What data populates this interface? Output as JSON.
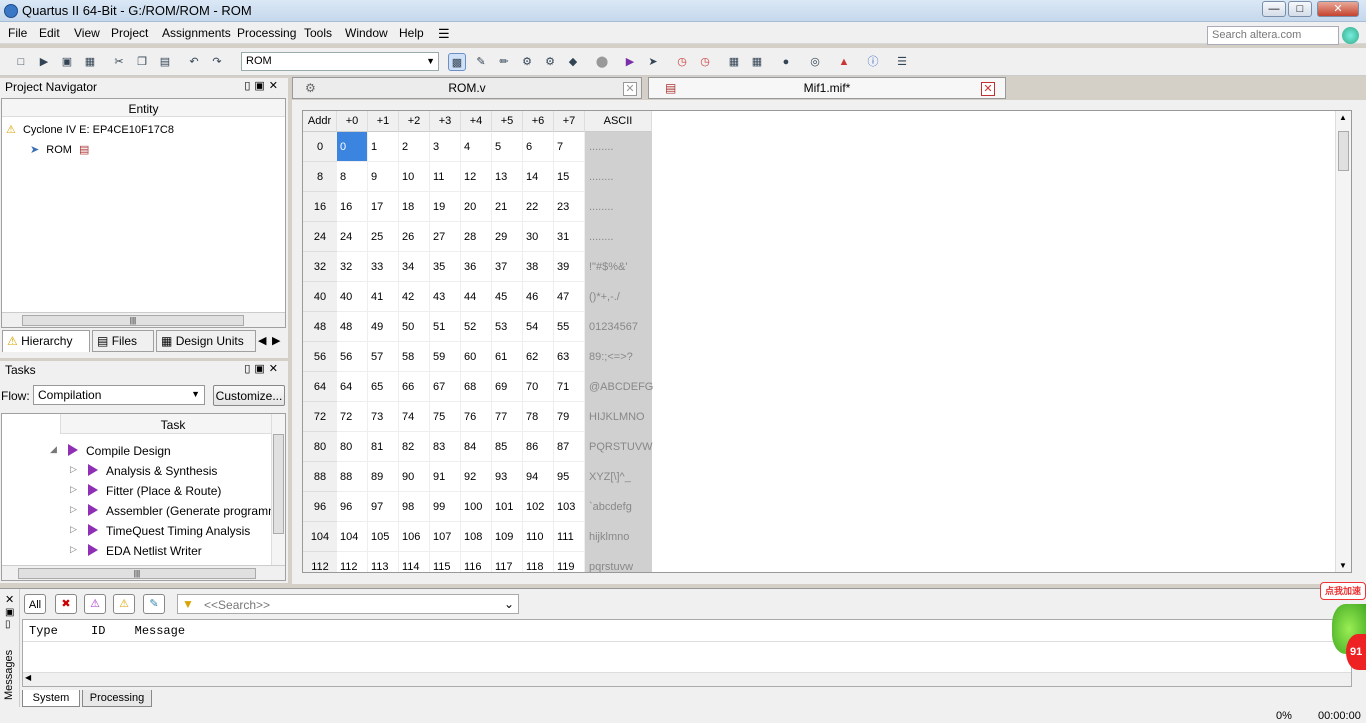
{
  "titlebar": {
    "title": "Quartus II 64-Bit - G:/ROM/ROM - ROM"
  },
  "menu": [
    "File",
    "Edit",
    "View",
    "Project",
    "Assignments",
    "Processing",
    "Tools",
    "Window",
    "Help"
  ],
  "search": {
    "placeholder": "Search altera.com"
  },
  "toolbar": {
    "entity_value": "ROM"
  },
  "project_navigator": {
    "title": "Project Navigator",
    "column": "Entity",
    "device": "Cyclone IV E: EP4CE10F17C8",
    "top_entity": "ROM",
    "tabs": [
      "Hierarchy",
      "Files",
      "Design Units"
    ]
  },
  "tasks": {
    "title": "Tasks",
    "flow_label": "Flow:",
    "flow_value": "Compilation",
    "customize_label": "Customize...",
    "column": "Task",
    "items": [
      {
        "label": "Compile Design"
      },
      {
        "label": "Analysis & Synthesis"
      },
      {
        "label": "Fitter (Place & Route)"
      },
      {
        "label": "Assembler (Generate programming"
      },
      {
        "label": "TimeQuest Timing Analysis"
      },
      {
        "label": "EDA Netlist Writer"
      }
    ]
  },
  "editor_tabs": [
    {
      "label": "ROM.v"
    },
    {
      "label": "Mif1.mif*"
    }
  ],
  "mif": {
    "headers": [
      "Addr",
      "+0",
      "+1",
      "+2",
      "+3",
      "+4",
      "+5",
      "+6",
      "+7",
      "ASCII"
    ],
    "rows": [
      {
        "addr": "0",
        "values": [
          "0",
          "1",
          "2",
          "3",
          "4",
          "5",
          "6",
          "7"
        ],
        "ascii": "........"
      },
      {
        "addr": "8",
        "values": [
          "8",
          "9",
          "10",
          "11",
          "12",
          "13",
          "14",
          "15"
        ],
        "ascii": "........"
      },
      {
        "addr": "16",
        "values": [
          "16",
          "17",
          "18",
          "19",
          "20",
          "21",
          "22",
          "23"
        ],
        "ascii": "........"
      },
      {
        "addr": "24",
        "values": [
          "24",
          "25",
          "26",
          "27",
          "28",
          "29",
          "30",
          "31"
        ],
        "ascii": "........"
      },
      {
        "addr": "32",
        "values": [
          "32",
          "33",
          "34",
          "35",
          "36",
          "37",
          "38",
          "39"
        ],
        "ascii": " !\"#$%&'"
      },
      {
        "addr": "40",
        "values": [
          "40",
          "41",
          "42",
          "43",
          "44",
          "45",
          "46",
          "47"
        ],
        "ascii": "()*+,-./"
      },
      {
        "addr": "48",
        "values": [
          "48",
          "49",
          "50",
          "51",
          "52",
          "53",
          "54",
          "55"
        ],
        "ascii": "01234567"
      },
      {
        "addr": "56",
        "values": [
          "56",
          "57",
          "58",
          "59",
          "60",
          "61",
          "62",
          "63"
        ],
        "ascii": "89:;<=>?"
      },
      {
        "addr": "64",
        "values": [
          "64",
          "65",
          "66",
          "67",
          "68",
          "69",
          "70",
          "71"
        ],
        "ascii": "@ABCDEFG"
      },
      {
        "addr": "72",
        "values": [
          "72",
          "73",
          "74",
          "75",
          "76",
          "77",
          "78",
          "79"
        ],
        "ascii": "HIJKLMNO"
      },
      {
        "addr": "80",
        "values": [
          "80",
          "81",
          "82",
          "83",
          "84",
          "85",
          "86",
          "87"
        ],
        "ascii": "PQRSTUVW"
      },
      {
        "addr": "88",
        "values": [
          "88",
          "89",
          "90",
          "91",
          "92",
          "93",
          "94",
          "95"
        ],
        "ascii": "XYZ[\\]^_"
      },
      {
        "addr": "96",
        "values": [
          "96",
          "97",
          "98",
          "99",
          "100",
          "101",
          "102",
          "103"
        ],
        "ascii": "`abcdefg"
      },
      {
        "addr": "104",
        "values": [
          "104",
          "105",
          "106",
          "107",
          "108",
          "109",
          "110",
          "111"
        ],
        "ascii": "hijklmno"
      },
      {
        "addr": "112",
        "values": [
          "112",
          "113",
          "114",
          "115",
          "116",
          "117",
          "118",
          "119"
        ],
        "ascii": "pqrstuvw"
      }
    ]
  },
  "messages": {
    "side_label": "Messages",
    "filter_all": "All",
    "search_placeholder": "<<Search>>",
    "columns": [
      "Type",
      "ID",
      "Message"
    ],
    "tabs": [
      "System",
      "Processing"
    ]
  },
  "overlay": {
    "label": "点我加速",
    "badge": "91"
  },
  "status": {
    "progress": "0%",
    "time": "00:00:00"
  }
}
